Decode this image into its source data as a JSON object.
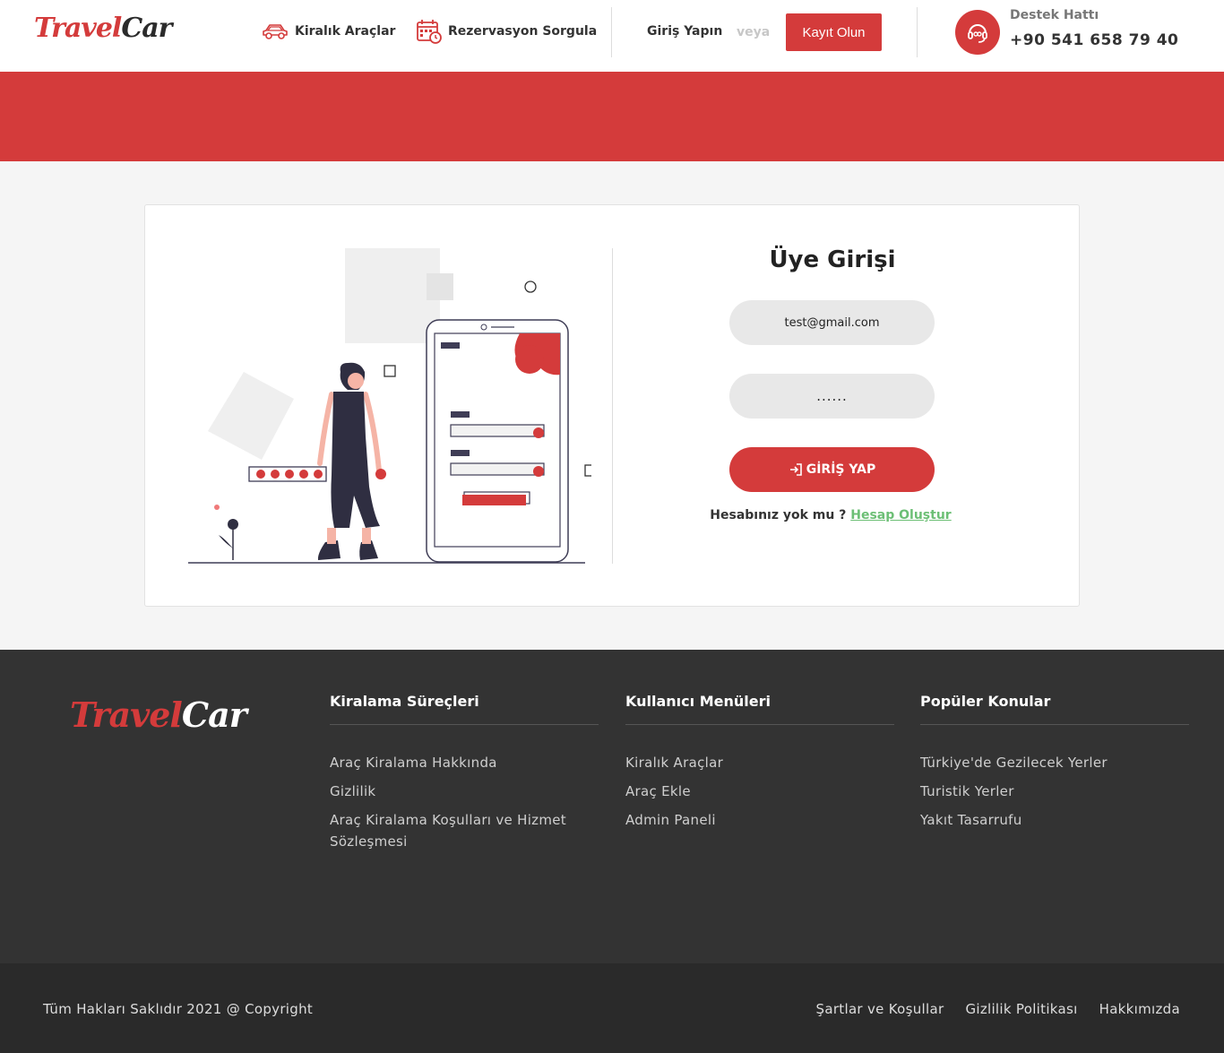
{
  "header": {
    "logo_part1": "Travel",
    "logo_part2": "Car",
    "nav": [
      {
        "label": "Kiralık Araçlar",
        "icon": "car-icon"
      },
      {
        "label": "Rezervasyon Sorgula",
        "icon": "calendar-icon"
      }
    ],
    "login_label": "Giriş Yapın",
    "or_label": "veya",
    "register_label": "Kayıt Olun",
    "support_label": "Destek Hattı",
    "support_phone": "+90 541 658 79 40",
    "support_icon": "headset-icon"
  },
  "login": {
    "title": "Üye Girişi",
    "email_value": "test@gmail.com",
    "password_value": "......",
    "submit_label": "GİRİŞ YAP",
    "submit_icon": "sign-in-icon",
    "no_account_text": "Hesabınız yok mu ?",
    "create_account_label": "Hesap Oluştur"
  },
  "footer": {
    "logo_part1": "Travel",
    "logo_part2": "Car",
    "columns": [
      {
        "title": "Kiralama Süreçleri",
        "items": [
          "Araç Kiralama Hakkında",
          "Gizlilik",
          "Araç Kiralama Koşulları ve Hizmet Sözleşmesi"
        ]
      },
      {
        "title": "Kullanıcı Menüleri",
        "items": [
          "Kiralık Araçlar",
          "Araç Ekle",
          "Admin Paneli"
        ]
      },
      {
        "title": "Popüler Konular",
        "items": [
          "Türkiye'de Gezilecek Yerler",
          "Turistik Yerler",
          "Yakıt Tasarrufu"
        ]
      }
    ],
    "copyright": "Tüm Hakları Saklıdır 2021 @ Copyright",
    "bottom_links": [
      "Şartlar ve Koşullar",
      "Gizlilik Politikası",
      "Hakkımızda"
    ]
  },
  "colors": {
    "brand_red": "#d43b3b",
    "link_green": "#6cbf75",
    "footer_bg": "#333333",
    "footer_bottom_bg": "#2a2a2a"
  }
}
